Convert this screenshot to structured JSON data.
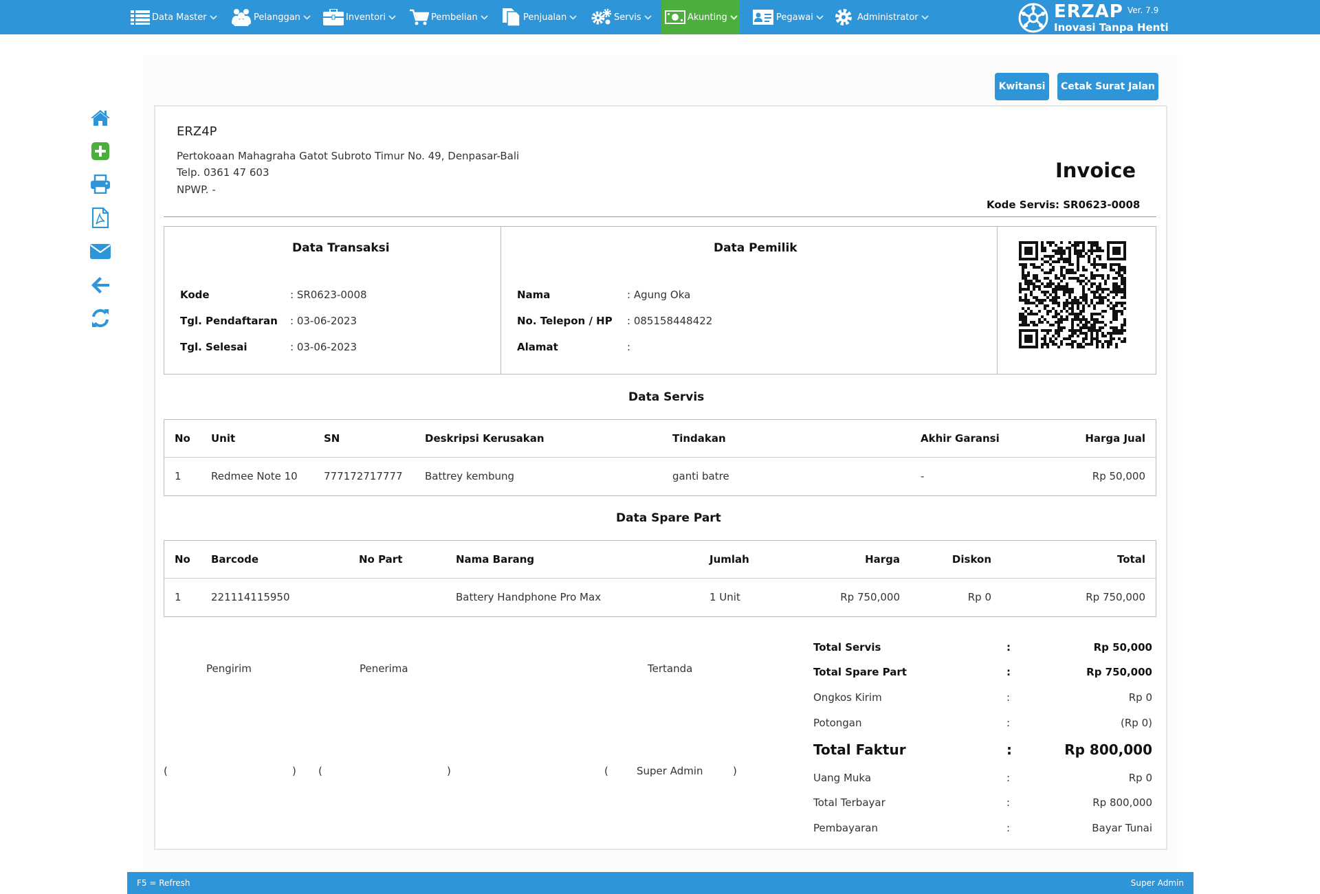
{
  "nav": {
    "items": [
      {
        "label": "Data Master",
        "icon": "list-icon"
      },
      {
        "label": "Pelanggan",
        "icon": "users-icon"
      },
      {
        "label": "Inventori",
        "icon": "briefcase-icon"
      },
      {
        "label": "Pembelian",
        "icon": "cart-icon"
      },
      {
        "label": "Penjualan",
        "icon": "document-icon"
      },
      {
        "label": "Servis",
        "icon": "gears-icon"
      },
      {
        "label": "Akunting",
        "icon": "money-icon"
      },
      {
        "label": "Pegawai",
        "icon": "id-card-icon"
      },
      {
        "label": "Administrator",
        "icon": "gear-icon"
      }
    ],
    "active": "Akunting"
  },
  "brand": {
    "name": "ERZAP",
    "version": "Ver. 7.9",
    "tagline": "Inovasi Tanpa Henti"
  },
  "actions": {
    "kwitansi": "Kwitansi",
    "cetak_surat_jalan": "Cetak Surat Jalan"
  },
  "sidebar_icons": [
    "home-icon",
    "add-icon",
    "print-icon",
    "pdf-icon",
    "email-icon",
    "back-arrow-icon",
    "refresh-icon"
  ],
  "company": {
    "name": "ERZ4P",
    "address": "Pertokoaan Mahagraha Gatot Subroto Timur No. 49, Denpasar-Bali",
    "phone": "Telp. 0361 47 603",
    "npwp": "NPWP. -"
  },
  "invoice": {
    "title": "Invoice",
    "kode_servis": "Kode Servis: SR0623-0008"
  },
  "transaksi": {
    "title": "Data Transaksi",
    "rows": [
      {
        "label": "Kode",
        "value": ": SR0623-0008"
      },
      {
        "label": "Tgl. Pendaftaran",
        "value": ": 03-06-2023"
      },
      {
        "label": "Tgl. Selesai",
        "value": ": 03-06-2023"
      }
    ]
  },
  "pemilik": {
    "title": "Data Pemilik",
    "rows": [
      {
        "label": "Nama",
        "value": ": Agung Oka"
      },
      {
        "label": "No. Telepon / HP",
        "value": ": 085158448422"
      },
      {
        "label": "Alamat",
        "value": ":"
      }
    ]
  },
  "servis": {
    "title": "Data Servis",
    "headers": [
      "No",
      "Unit",
      "SN",
      "Deskripsi Kerusakan",
      "Tindakan",
      "Akhir Garansi",
      "Harga Jual"
    ],
    "rows": [
      [
        "1",
        "Redmee Note 10",
        "777172717777",
        "Battrey kembung",
        "ganti batre",
        "-",
        "Rp 50,000"
      ]
    ]
  },
  "sparepart": {
    "title": "Data Spare Part",
    "headers": [
      "No",
      "Barcode",
      "No Part",
      "Nama Barang",
      "Jumlah",
      "Harga",
      "Diskon",
      "Total"
    ],
    "rows": [
      [
        "1",
        "221114115950",
        "",
        "Battery Handphone Pro Max",
        "1 Unit",
        "Rp 750,000",
        "Rp 0",
        "Rp 750,000"
      ]
    ]
  },
  "signatures": {
    "pengirim": "Pengirim",
    "penerima": "Penerima",
    "tertanda": "Tertanda",
    "signer": "Super Admin",
    "open": "(",
    "close": ")"
  },
  "totals": [
    {
      "label": "Total Servis",
      "sep": ":",
      "value": "Rp 50,000",
      "style": "bold"
    },
    {
      "label": "Total Spare Part",
      "sep": ":",
      "value": "Rp 750,000",
      "style": "bold"
    },
    {
      "label": "Ongkos Kirim",
      "sep": ":",
      "value": "Rp 0",
      "style": "normal"
    },
    {
      "label": "Potongan",
      "sep": ":",
      "value": "(Rp 0)",
      "style": "normal"
    },
    {
      "label": "Total Faktur",
      "sep": ":",
      "value": "Rp 800,000",
      "style": "big"
    },
    {
      "label": "Uang Muka",
      "sep": ":",
      "value": "Rp 0",
      "style": "normal"
    },
    {
      "label": "Total Terbayar",
      "sep": ":",
      "value": "Rp 800,000",
      "style": "normal"
    },
    {
      "label": "Pembayaran",
      "sep": ":",
      "value": "Bayar Tunai",
      "style": "normal"
    }
  ],
  "footer": {
    "left": "F5 = Refresh",
    "right": "Super Admin"
  },
  "colors": {
    "primary": "#2e95d9",
    "active_nav": "#4cae3c"
  }
}
